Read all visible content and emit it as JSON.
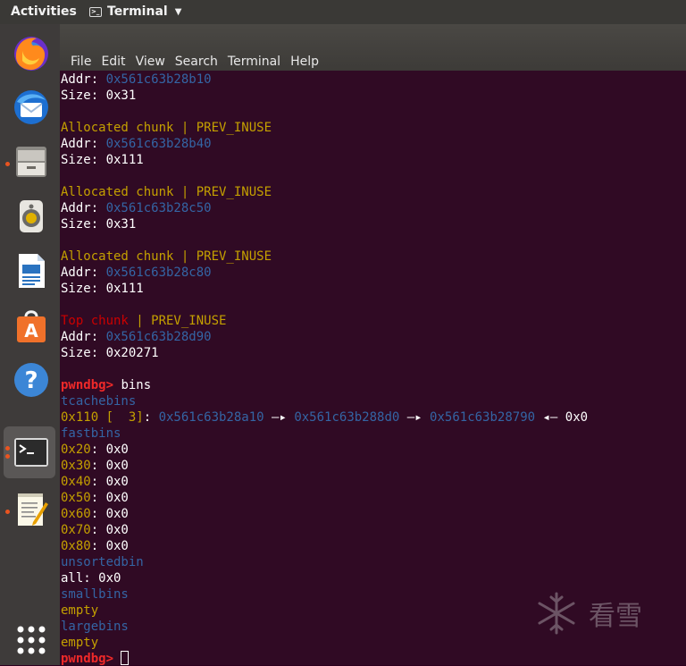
{
  "topbar": {
    "activities_label": "Activities",
    "app_label": "Terminal"
  },
  "menubar": {
    "items": [
      "File",
      "Edit",
      "View",
      "Search",
      "Terminal",
      "Help"
    ]
  },
  "dock": {
    "items": [
      {
        "name": "firefox"
      },
      {
        "name": "thunderbird"
      },
      {
        "name": "files"
      },
      {
        "name": "rhythmbox"
      },
      {
        "name": "libreoffice-writer"
      },
      {
        "name": "software-center"
      },
      {
        "name": "help"
      },
      {
        "name": "terminal"
      },
      {
        "name": "text-editor"
      },
      {
        "name": "show-applications"
      }
    ]
  },
  "terminal": {
    "lines": [
      [
        {
          "t": "Addr: ",
          "c": "white"
        },
        {
          "t": "0x561c63b28b10",
          "c": "blue"
        }
      ],
      [
        {
          "t": "Size: 0x31",
          "c": "white"
        }
      ],
      [],
      [
        {
          "t": "Allocated chunk | PREV_INUSE",
          "c": "yellow"
        }
      ],
      [
        {
          "t": "Addr: ",
          "c": "white"
        },
        {
          "t": "0x561c63b28b40",
          "c": "blue"
        }
      ],
      [
        {
          "t": "Size: 0x111",
          "c": "white"
        }
      ],
      [],
      [
        {
          "t": "Allocated chunk | PREV_INUSE",
          "c": "yellow"
        }
      ],
      [
        {
          "t": "Addr: ",
          "c": "white"
        },
        {
          "t": "0x561c63b28c50",
          "c": "blue"
        }
      ],
      [
        {
          "t": "Size: 0x31",
          "c": "white"
        }
      ],
      [],
      [
        {
          "t": "Allocated chunk | PREV_INUSE",
          "c": "yellow"
        }
      ],
      [
        {
          "t": "Addr: ",
          "c": "white"
        },
        {
          "t": "0x561c63b28c80",
          "c": "blue"
        }
      ],
      [
        {
          "t": "Size: 0x111",
          "c": "white"
        }
      ],
      [],
      [
        {
          "t": "Top chunk",
          "c": "red"
        },
        {
          "t": " | PREV_INUSE",
          "c": "yellow"
        }
      ],
      [
        {
          "t": "Addr: ",
          "c": "white"
        },
        {
          "t": "0x561c63b28d90",
          "c": "blue"
        }
      ],
      [
        {
          "t": "Size: 0x20271",
          "c": "white"
        }
      ],
      [],
      [
        {
          "t": "pwndbg> ",
          "c": "prompt"
        },
        {
          "t": "bins",
          "c": "white"
        }
      ],
      [
        {
          "t": "tcachebins",
          "c": "blue"
        }
      ],
      [
        {
          "t": "0x110 [  3]",
          "c": "yellow"
        },
        {
          "t": ": ",
          "c": "white"
        },
        {
          "t": "0x561c63b28a10",
          "c": "blue"
        },
        {
          "t": " —▸ ",
          "c": "white"
        },
        {
          "t": "0x561c63b288d0",
          "c": "blue"
        },
        {
          "t": " —▸ ",
          "c": "white"
        },
        {
          "t": "0x561c63b28790",
          "c": "blue"
        },
        {
          "t": " ◂— 0x0",
          "c": "white"
        }
      ],
      [
        {
          "t": "fastbins",
          "c": "blue"
        }
      ],
      [
        {
          "t": "0x20",
          "c": "yellow"
        },
        {
          "t": ": 0x0",
          "c": "white"
        }
      ],
      [
        {
          "t": "0x30",
          "c": "yellow"
        },
        {
          "t": ": 0x0",
          "c": "white"
        }
      ],
      [
        {
          "t": "0x40",
          "c": "yellow"
        },
        {
          "t": ": 0x0",
          "c": "white"
        }
      ],
      [
        {
          "t": "0x50",
          "c": "yellow"
        },
        {
          "t": ": 0x0",
          "c": "white"
        }
      ],
      [
        {
          "t": "0x60",
          "c": "yellow"
        },
        {
          "t": ": 0x0",
          "c": "white"
        }
      ],
      [
        {
          "t": "0x70",
          "c": "yellow"
        },
        {
          "t": ": 0x0",
          "c": "white"
        }
      ],
      [
        {
          "t": "0x80",
          "c": "yellow"
        },
        {
          "t": ": 0x0",
          "c": "white"
        }
      ],
      [
        {
          "t": "unsortedbin",
          "c": "blue"
        }
      ],
      [
        {
          "t": "all: 0x0",
          "c": "white"
        }
      ],
      [
        {
          "t": "smallbins",
          "c": "blue"
        }
      ],
      [
        {
          "t": "empty",
          "c": "yellow"
        }
      ],
      [
        {
          "t": "largebins",
          "c": "blue"
        }
      ],
      [
        {
          "t": "empty",
          "c": "yellow"
        }
      ],
      [
        {
          "t": "pwndbg> ",
          "c": "prompt"
        },
        {
          "t": "",
          "c": "cursor"
        }
      ]
    ]
  },
  "watermark": {
    "text": "看雪"
  },
  "colors": {
    "terminal_bg": "#300a24",
    "yellow": "#c4a000",
    "blue": "#3465a4",
    "red": "#cc0000",
    "prompt": "#ef2929",
    "accent": "#e95420"
  }
}
